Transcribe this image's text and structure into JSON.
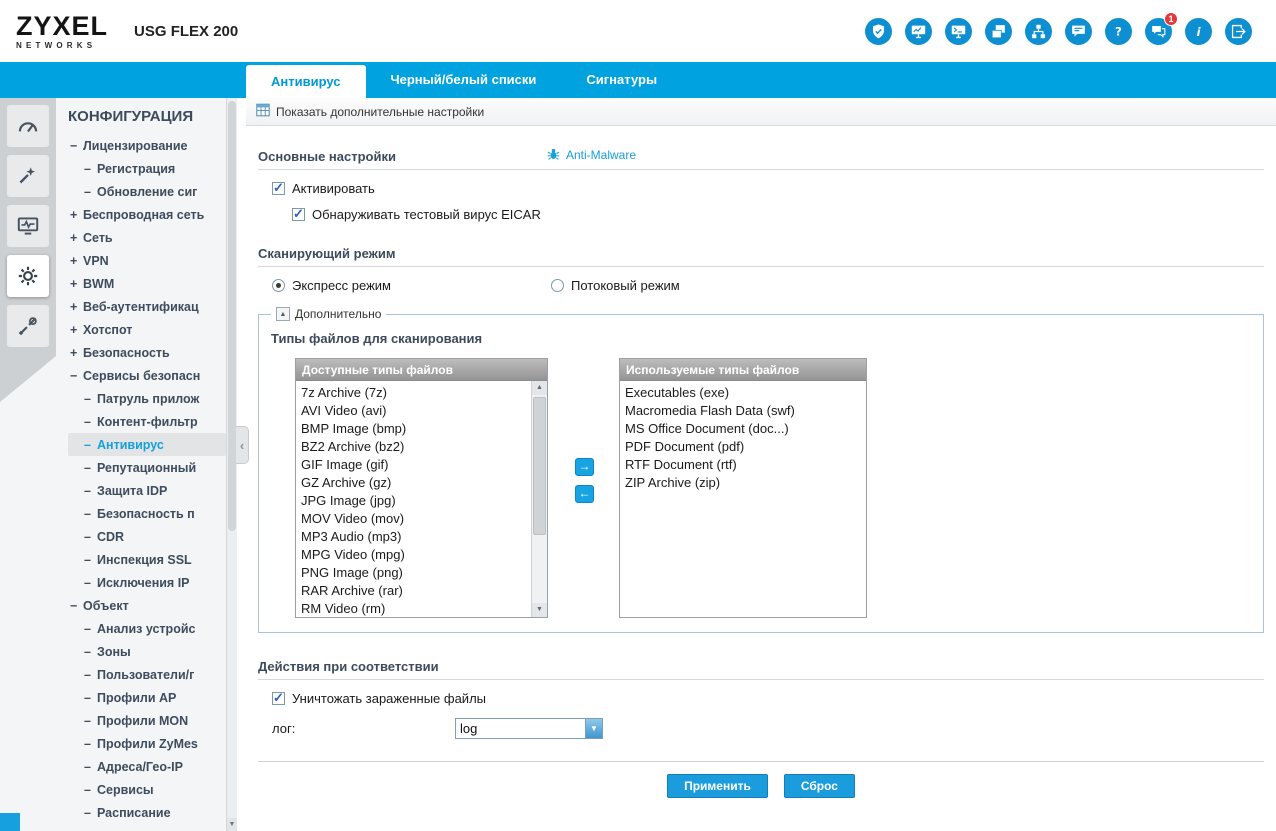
{
  "colors": {
    "accent": "#00a2df",
    "icon_blue": "#0d8fd2",
    "link": "#16a0dc",
    "badge": "#e03a3a",
    "button": "#1b9ddd"
  },
  "header": {
    "logo_main": "ZYXEL",
    "logo_sub": "NETWORKS",
    "model": "USG FLEX 200",
    "icons": [
      {
        "name": "securereporter-shield-icon",
        "badge": ""
      },
      {
        "name": "dashboard-monitor-icon",
        "badge": ""
      },
      {
        "name": "terminal-monitor-icon",
        "badge": ""
      },
      {
        "name": "windows-copy-icon",
        "badge": ""
      },
      {
        "name": "sitemap-icon",
        "badge": ""
      },
      {
        "name": "console-chat-icon",
        "badge": ""
      },
      {
        "name": "help-icon",
        "badge": ""
      },
      {
        "name": "notifications-icon",
        "badge": "1"
      },
      {
        "name": "info-icon",
        "badge": ""
      },
      {
        "name": "logout-icon",
        "badge": ""
      }
    ]
  },
  "tabs": [
    {
      "label": "Антивирус",
      "active": true
    },
    {
      "label": "Черный/белый списки",
      "active": false
    },
    {
      "label": "Сигнатуры",
      "active": false
    }
  ],
  "sidebar": {
    "title": "КОНФИГУРАЦИЯ",
    "rail_icons": [
      "gauge-icon",
      "wizard-icon",
      "monitor-activity-icon",
      "gear-icon",
      "tools-icon"
    ],
    "items": [
      {
        "label": "Лицензирование",
        "level": 0,
        "prefix": "−",
        "selected": false
      },
      {
        "label": "Регистрация",
        "level": 1,
        "prefix": "–",
        "selected": false
      },
      {
        "label": "Обновление сиг",
        "level": 1,
        "prefix": "–",
        "selected": false
      },
      {
        "label": "Беспроводная сеть",
        "level": 0,
        "prefix": "+",
        "selected": false
      },
      {
        "label": "Сеть",
        "level": 0,
        "prefix": "+",
        "selected": false
      },
      {
        "label": "VPN",
        "level": 0,
        "prefix": "+",
        "selected": false
      },
      {
        "label": "BWM",
        "level": 0,
        "prefix": "+",
        "selected": false
      },
      {
        "label": "Веб-аутентификац",
        "level": 0,
        "prefix": "+",
        "selected": false
      },
      {
        "label": "Хотспот",
        "level": 0,
        "prefix": "+",
        "selected": false
      },
      {
        "label": "Безопасность",
        "level": 0,
        "prefix": "+",
        "selected": false
      },
      {
        "label": "Сервисы безопасн",
        "level": 0,
        "prefix": "−",
        "selected": false
      },
      {
        "label": "Патруль прилож",
        "level": 1,
        "prefix": "–",
        "selected": false
      },
      {
        "label": "Контент-фильтр",
        "level": 1,
        "prefix": "–",
        "selected": false
      },
      {
        "label": "Антивирус",
        "level": 1,
        "prefix": "–",
        "selected": true
      },
      {
        "label": "Репутационный",
        "level": 1,
        "prefix": "–",
        "selected": false
      },
      {
        "label": "Защита IDP",
        "level": 1,
        "prefix": "–",
        "selected": false
      },
      {
        "label": "Безопасность п",
        "level": 1,
        "prefix": "–",
        "selected": false
      },
      {
        "label": "CDR",
        "level": 1,
        "prefix": "–",
        "selected": false
      },
      {
        "label": "Инспекция SSL",
        "level": 1,
        "prefix": "–",
        "selected": false
      },
      {
        "label": "Исключения IP",
        "level": 1,
        "prefix": "–",
        "selected": false
      },
      {
        "label": "Объект",
        "level": 0,
        "prefix": "−",
        "selected": false
      },
      {
        "label": "Анализ устройс",
        "level": 1,
        "prefix": "–",
        "selected": false
      },
      {
        "label": "Зоны",
        "level": 1,
        "prefix": "–",
        "selected": false
      },
      {
        "label": "Пользователи/г",
        "level": 1,
        "prefix": "–",
        "selected": false
      },
      {
        "label": "Профили AP",
        "level": 1,
        "prefix": "–",
        "selected": false
      },
      {
        "label": "Профили MON",
        "level": 1,
        "prefix": "–",
        "selected": false
      },
      {
        "label": "Профили ZyMes",
        "level": 1,
        "prefix": "–",
        "selected": false
      },
      {
        "label": "Адреса/Гео-IP",
        "level": 1,
        "prefix": "–",
        "selected": false
      },
      {
        "label": "Сервисы",
        "level": 1,
        "prefix": "–",
        "selected": false
      },
      {
        "label": "Расписание",
        "level": 1,
        "prefix": "–",
        "selected": false
      }
    ]
  },
  "content": {
    "subheader": {
      "label": "Показать дополнительные настройки"
    },
    "general": {
      "title": "Основные настройки",
      "antimalware_link": "Anti-Malware",
      "activate_label": "Активировать",
      "eicar_label": "Обнаруживать тестовый вирус EICAR"
    },
    "scan_mode": {
      "title": "Сканирующий режим",
      "express_label": "Экспресс режим",
      "stream_label": "Потоковый режим"
    },
    "advanced": {
      "legend": "Дополнительно",
      "collapse_glyph": "▲",
      "file_types_title": "Типы файлов для сканирования",
      "available_header": "Доступные типы файлов",
      "available_items": [
        "7z Archive (7z)",
        "AVI Video (avi)",
        "BMP Image (bmp)",
        "BZ2 Archive (bz2)",
        "GIF Image (gif)",
        "GZ Archive (gz)",
        "JPG Image (jpg)",
        "MOV Video (mov)",
        "MP3 Audio (mp3)",
        "MPG Video (mpg)",
        "PNG Image (png)",
        "RAR Archive (rar)",
        "RM Video (rm)"
      ],
      "used_header": "Используемые типы файлов",
      "used_items": [
        "Executables (exe)",
        "Macromedia Flash Data (swf)",
        "MS Office Document (doc...)",
        "PDF Document (pdf)",
        "RTF Document (rtf)",
        "ZIP Archive (zip)"
      ],
      "move_right_glyph": "→",
      "move_left_glyph": "←"
    },
    "match_actions": {
      "title": "Действия при соответствии",
      "destroy_label": "Уничтожать зараженные файлы",
      "log_label": "лог:",
      "log_value": "log"
    },
    "buttons": {
      "apply": "Применить",
      "reset": "Сброс"
    }
  }
}
